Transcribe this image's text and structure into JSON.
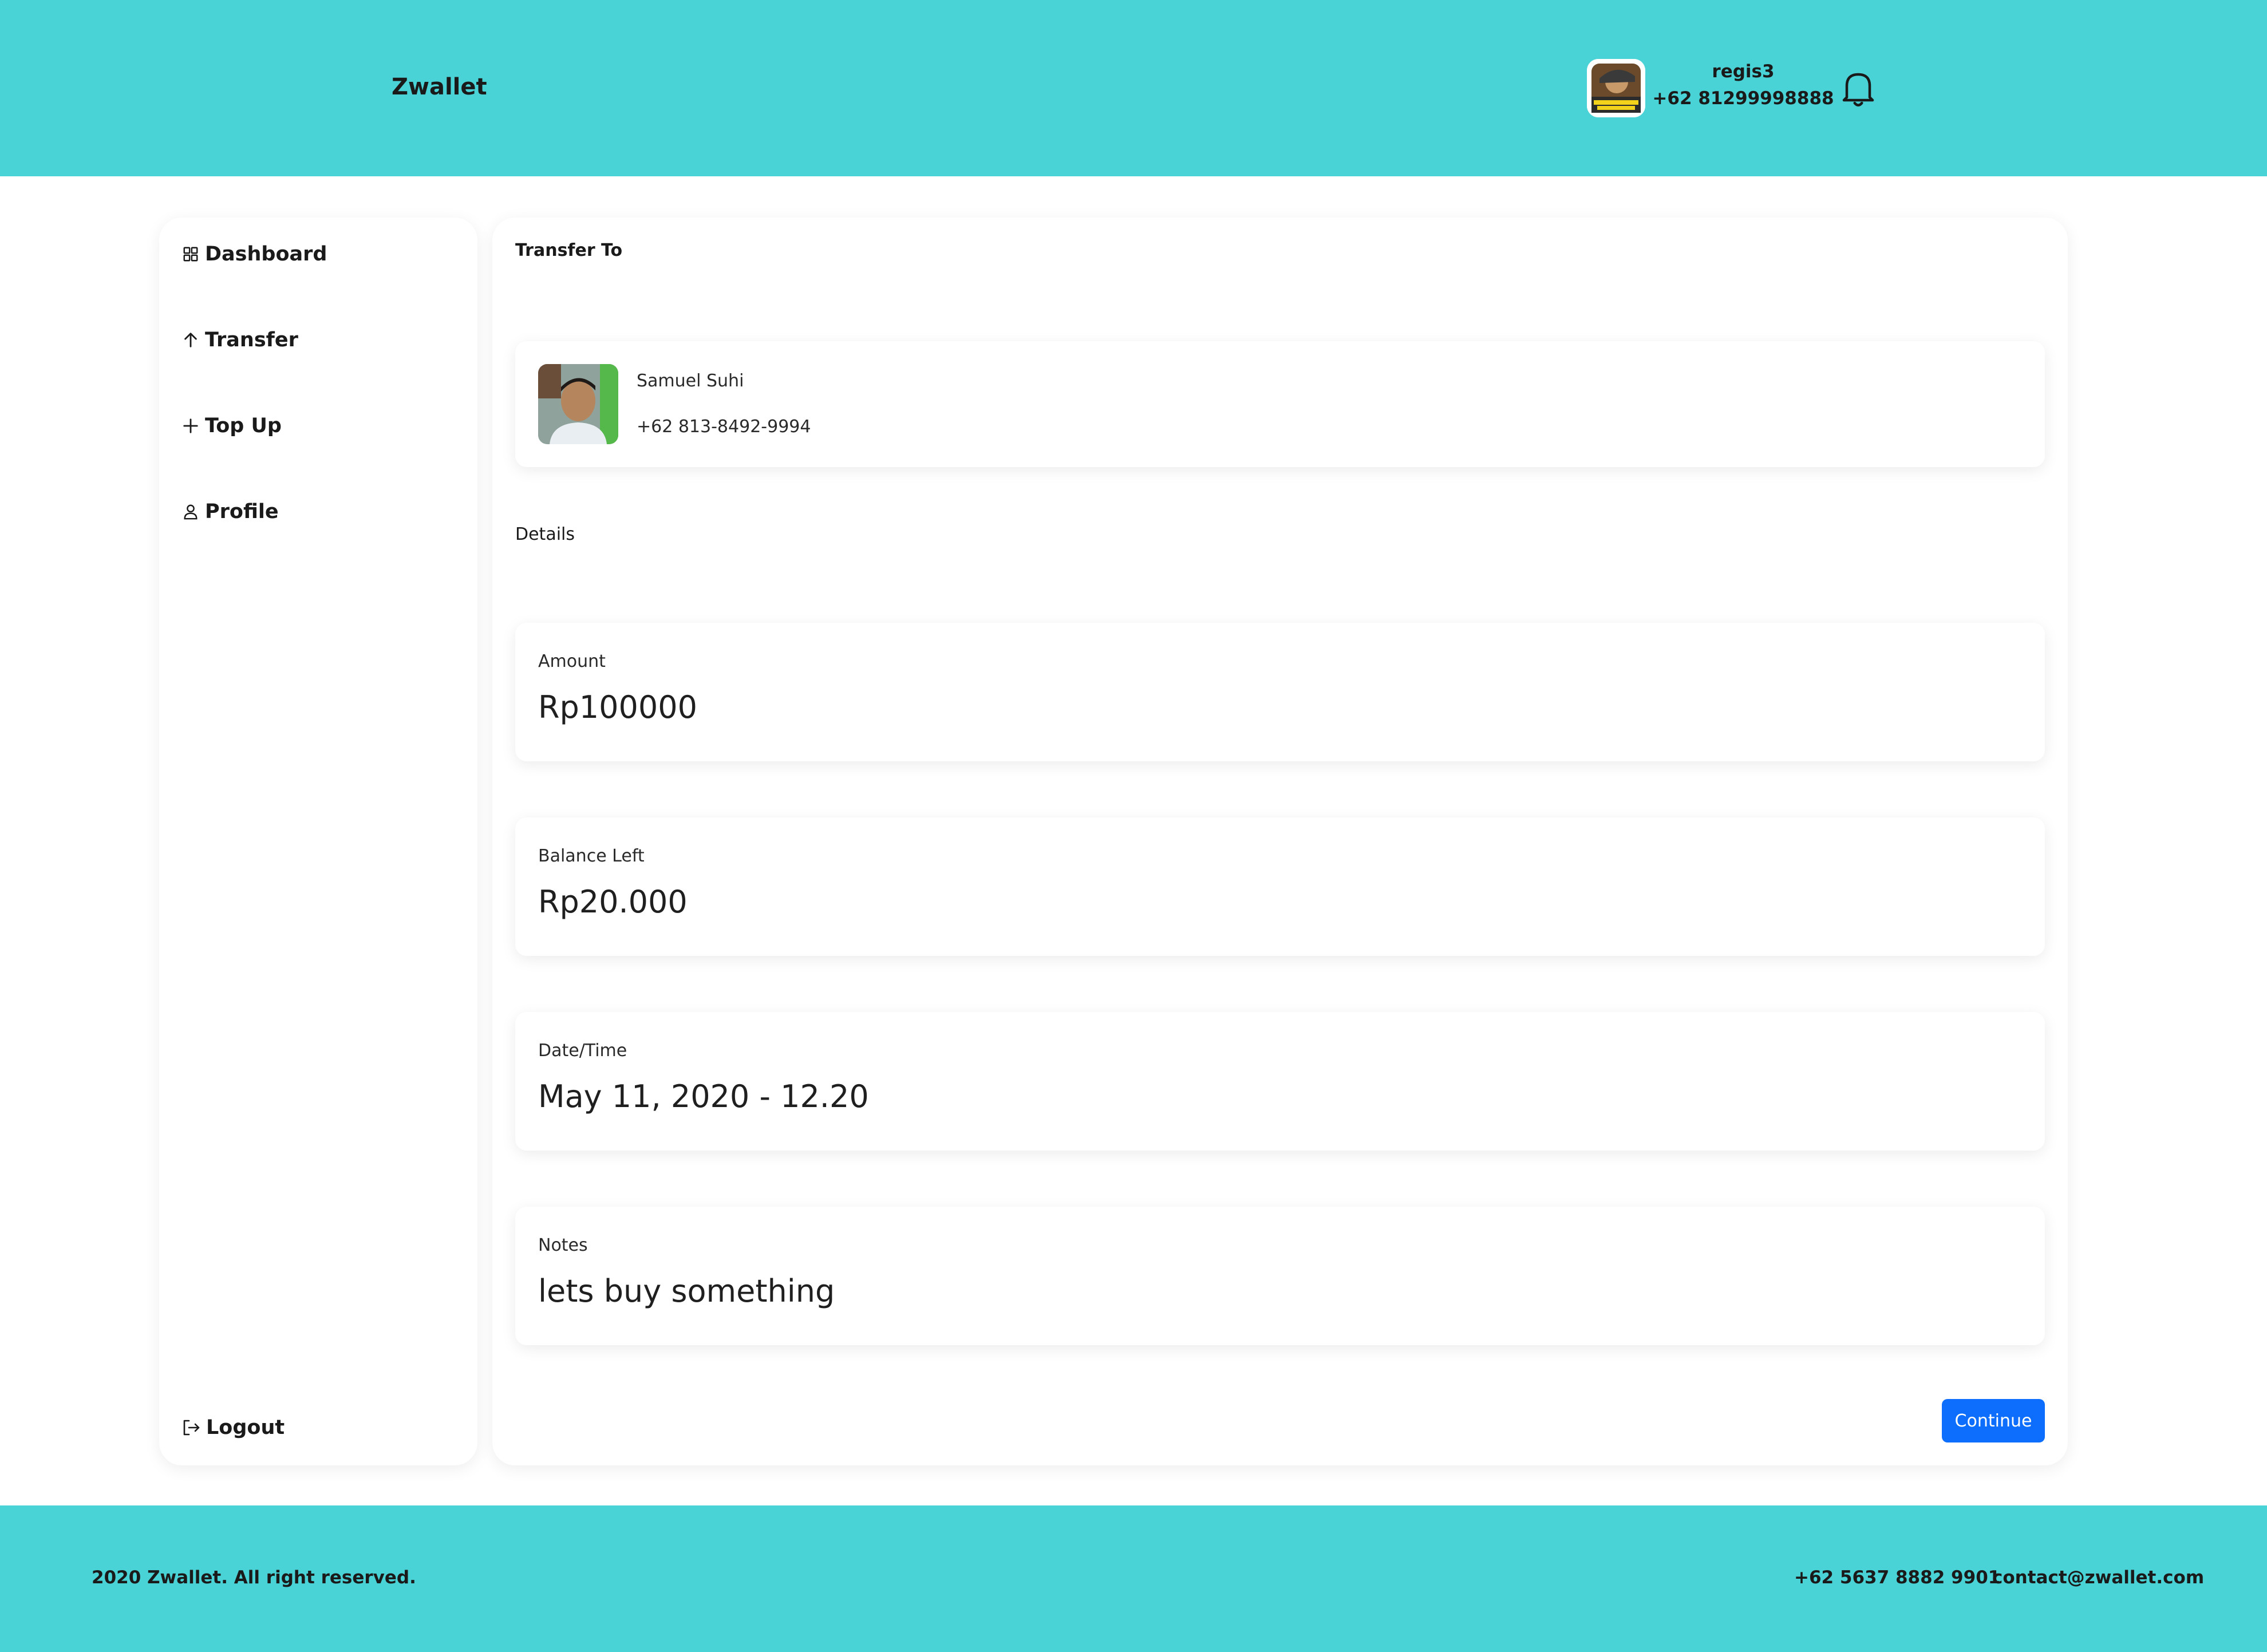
{
  "header": {
    "brand": "Zwallet",
    "user": {
      "name": "regis3",
      "phone": "+62 81299998888"
    }
  },
  "sidebar": {
    "items": [
      {
        "label": "Dashboard",
        "icon": "grid-icon"
      },
      {
        "label": "Transfer",
        "icon": "arrow-up-icon"
      },
      {
        "label": "Top Up",
        "icon": "plus-icon"
      },
      {
        "label": "Profile",
        "icon": "user-icon"
      }
    ],
    "logout": {
      "label": "Logout",
      "icon": "logout-icon"
    }
  },
  "main": {
    "transfer_to_label": "Transfer To",
    "recipient": {
      "name": "Samuel Suhi",
      "phone": "+62 813-8492-9994"
    },
    "details_label": "Details",
    "details": {
      "amount": {
        "label": "Amount",
        "value": "Rp100000"
      },
      "balance": {
        "label": "Balance Left",
        "value": "Rp20.000"
      },
      "datetime": {
        "label": "Date/Time",
        "value": "May 11, 2020 - 12.20"
      },
      "notes": {
        "label": "Notes",
        "value": "lets buy something"
      }
    },
    "continue_label": "Continue"
  },
  "footer": {
    "copyright": "2020 Zwallet. All right reserved.",
    "phone": "+62 5637 8882 9901",
    "email": "contact@zwallet.com"
  },
  "colors": {
    "header_bg": "#4ad3d6",
    "footer_bg": "#4ad3d6",
    "button_primary": "#0d6efd"
  }
}
